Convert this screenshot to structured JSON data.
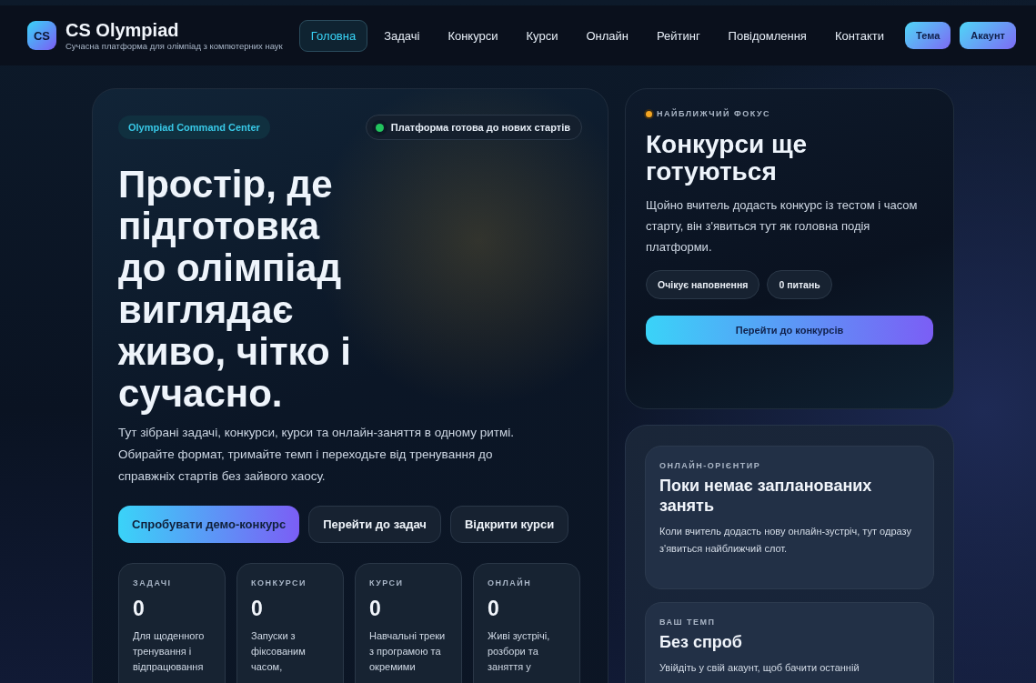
{
  "header": {
    "logo": "CS",
    "title": "CS Olympiad",
    "subtitle": "Сучасна платформа для олімпіад з компютерних наук",
    "nav": [
      {
        "label": "Головна",
        "selected": true
      },
      {
        "label": "Задачі",
        "selected": false
      },
      {
        "label": "Конкурси",
        "selected": false
      },
      {
        "label": "Курси",
        "selected": false
      },
      {
        "label": "Онлайн",
        "selected": false
      },
      {
        "label": "Рейтинг",
        "selected": false
      },
      {
        "label": "Повідомлення",
        "selected": false
      },
      {
        "label": "Контакти",
        "selected": false
      }
    ],
    "buttons": [
      "Тема",
      "Акаунт"
    ]
  },
  "hero": {
    "badge": "Olympiad Command Center",
    "status": {
      "text": "Платформа готова до нових стартів",
      "color": "#22c55e"
    },
    "title": "Простір, де підготовка до олімпіад виглядає живо, чітко і сучасно.",
    "description": "Тут зібрані задачі, конкурси, курси та онлайн-заняття в одному ритмі. Обирайте формат, тримайте темп і переходьте від тренування до справжніх стартів без зайвого хаосу.",
    "actions": [
      {
        "label": "Спробувати демо-конкурс",
        "kind": "primary"
      },
      {
        "label": "Перейти до задач",
        "kind": "secondary"
      },
      {
        "label": "Відкрити курси",
        "kind": "secondary"
      }
    ],
    "stats": [
      {
        "label": "ЗАДАЧІ",
        "value": "0",
        "text": "Для щоденного тренування і відпрацювання"
      },
      {
        "label": "КОНКУРСИ",
        "value": "0",
        "text": "Запуски з фіксованим часом,"
      },
      {
        "label": "КУРСИ",
        "value": "0",
        "text": "Навчальні треки з програмою та окремими"
      },
      {
        "label": "ОНЛАЙН",
        "value": "0",
        "text": "Живі зустрічі, розбори та заняття у"
      }
    ]
  },
  "focus": {
    "eyebrow": "НАЙБЛИЖЧИЙ ФОКУС",
    "title": "Конкурси ще готуються",
    "text": "Щойно вчитель додасть конкурс із тестом і часом старту, він з'явиться тут як головна подія платформи.",
    "chips": [
      "Очікує наповнення",
      "0 питань"
    ],
    "button": "Перейти до конкурсів"
  },
  "side_cards": [
    {
      "eyebrow": "ОНЛАЙН-ОРІЄНТИР",
      "title": "Поки немає запланованих занять",
      "text": "Коли вчитель додасть нову онлайн-зустріч, тут одразу з'явиться найближчий слот."
    },
    {
      "eyebrow": "ВАШ ТЕМП",
      "title": "Без спроб",
      "text": "Увійдіть у свій акаунт, щоб бачити останній"
    }
  ]
}
